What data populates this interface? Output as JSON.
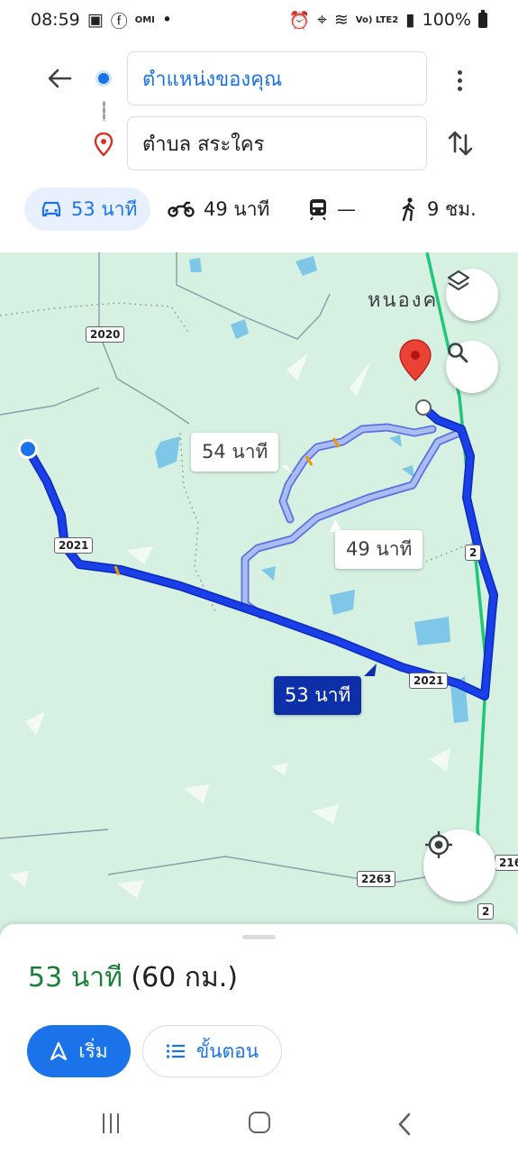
{
  "status_bar": {
    "time": "08:59",
    "left_small": "OMI",
    "network_label": "Vo) LTE2",
    "battery": "100%"
  },
  "header": {
    "origin": "ตำแหน่งของคุณ",
    "destination": "ตำบล สระใคร"
  },
  "modes": {
    "car": "53 นาที",
    "bike": "49 นาที",
    "transit": "—",
    "walk": "9 ชม."
  },
  "map": {
    "town_label": "หนองค",
    "shields": {
      "r2020": "2020",
      "r2021_a": "2021",
      "r2021_b": "2021",
      "r2": "2",
      "r2263": "2263",
      "r2_b": "2",
      "r216": "216"
    },
    "alt_route_1": "54 นาที",
    "alt_route_2": "49 นาที",
    "primary_route": "53 นาที",
    "colors": {
      "map_bg": "#d6f0e1",
      "primary_route": "#1a3ee8",
      "alt_route": "#a9bdf2",
      "highway": "#1fc77a",
      "water": "#7fc7e8"
    }
  },
  "sheet": {
    "summary_time": "53 นาที",
    "summary_distance": "(60 กม.)",
    "start_label": "เริ่ม",
    "steps_label": "ขั้นตอน"
  }
}
